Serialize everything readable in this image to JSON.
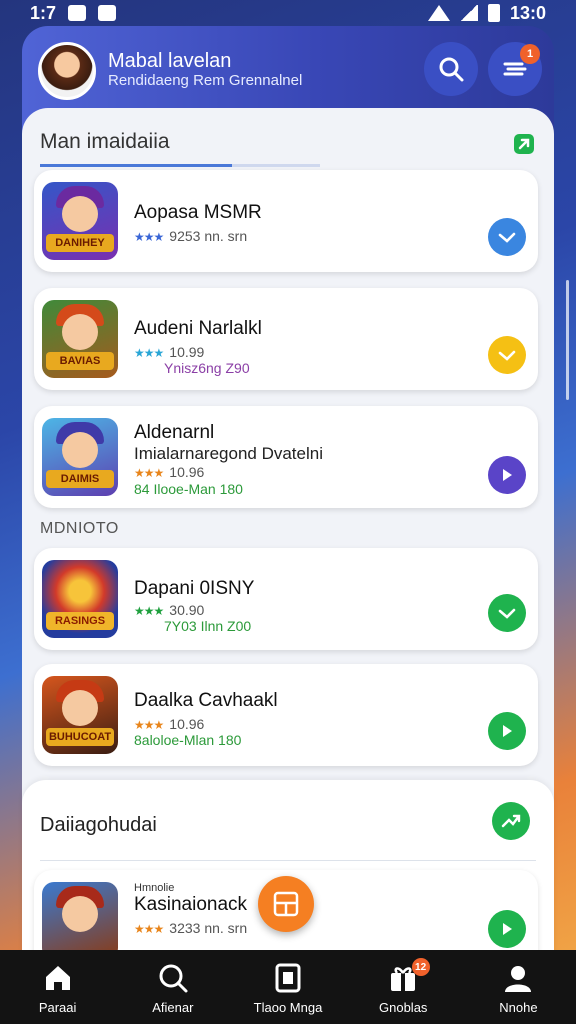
{
  "status": {
    "time_left": "1:7",
    "time_right": "13:0"
  },
  "header": {
    "title": "Mabal lavelan",
    "subtitle": "Rendidaeng Rem Grennalnel",
    "menu_badge": "1"
  },
  "section1": {
    "title": "Man imaidaiia"
  },
  "cards": [
    {
      "title": "Aopasa MSMR",
      "line1_stars": "★★★",
      "line1": "9253 nn. srn",
      "line2": "",
      "banner": "DANIHEY",
      "action": "check",
      "action_color": "#3a86e0"
    },
    {
      "title": "Audeni Narlalkl",
      "line1_stars": "★★★",
      "line1": "10.99",
      "line2": "Ynisz6ng Z90",
      "banner": "BAVIAS",
      "action": "check",
      "action_color": "#f5c014"
    },
    {
      "title": "Aldenarnl",
      "subtitle": "Imialarnaregond Dvatelni",
      "line1_stars": "★★★",
      "line1": "10.96",
      "line2": "84 Ilooe-Man 180",
      "banner": "DAIMIS",
      "action": "play",
      "action_color": "#5a44c8"
    },
    {
      "title": "Dapani 0ISNY",
      "line1_stars": "★★★",
      "line1": "30.90",
      "line2": "7Y03 Ilnn Z00",
      "banner": "RASINGS",
      "action": "check",
      "action_color": "#1fb34e"
    },
    {
      "title": "Daalka Cavhaakl",
      "line1_stars": "★★★",
      "line1": "10.96",
      "line2": "8aloloe-Mlan 180",
      "banner": "BUHUCOAT",
      "action": "play",
      "action_color": "#1fb34e"
    }
  ],
  "mid_label": "MDNIOTO",
  "section3": {
    "title": "Daiiagohudai",
    "card": {
      "kicker": "Hmnolie",
      "title": "Kasinaionack",
      "line1_stars": "★★★",
      "line1": "3233 nn. srn"
    }
  },
  "nav": [
    {
      "label": "Paraai",
      "icon": "home-icon"
    },
    {
      "label": "Afienar",
      "icon": "search-icon"
    },
    {
      "label": "Tlaoo Mnga",
      "icon": "square-icon"
    },
    {
      "label": "Gnoblas",
      "icon": "gift-icon",
      "badge": "12"
    },
    {
      "label": "Nnohe",
      "icon": "profile-icon"
    }
  ]
}
